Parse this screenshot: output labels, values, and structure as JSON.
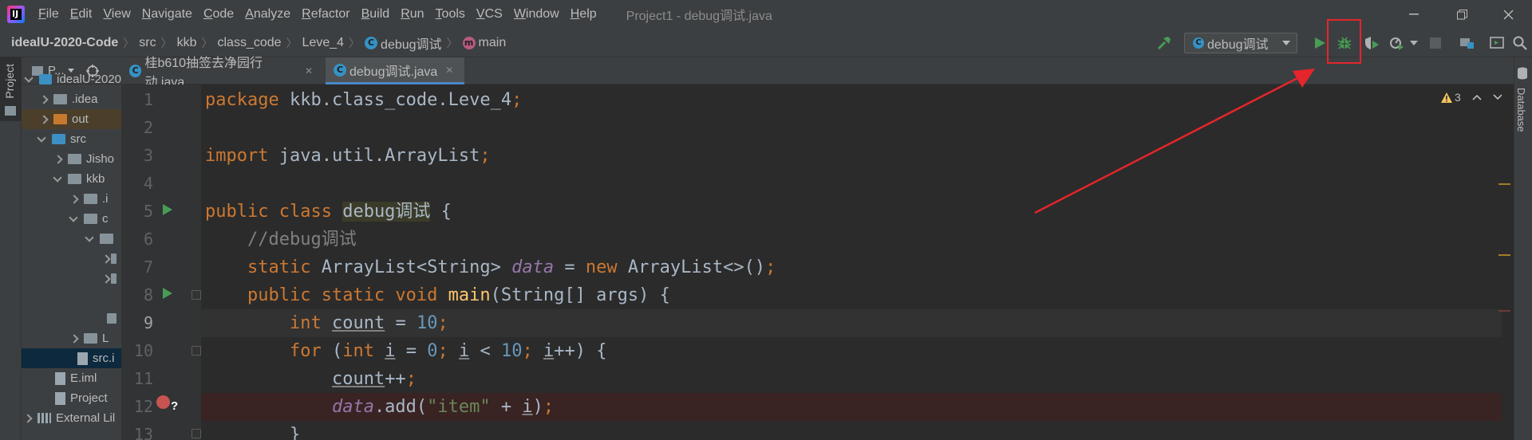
{
  "menu": {
    "items": [
      "File",
      "Edit",
      "View",
      "Navigate",
      "Code",
      "Analyze",
      "Refactor",
      "Build",
      "Run",
      "Tools",
      "VCS",
      "Window",
      "Help"
    ],
    "window_title": "Project1 - debug调试.java"
  },
  "breadcrumb": {
    "project": "idealU-2020-Code",
    "items": [
      "src",
      "kkb",
      "class_code",
      "Leve_4",
      "debug调试",
      "main"
    ]
  },
  "toolbar": {
    "run_config": "debug调试",
    "highlighted": "debug-button"
  },
  "project_panel": {
    "tab_label": "Project",
    "header": "P...",
    "tree": [
      {
        "label": "idealU-2020",
        "icon": "folder"
      },
      {
        "label": ".idea",
        "icon": "folder"
      },
      {
        "label": "out",
        "icon": "folder"
      },
      {
        "label": "src",
        "icon": "folder"
      },
      {
        "label": "Jisho",
        "icon": "package"
      },
      {
        "label": "kkb",
        "icon": "package"
      },
      {
        "label": ".i",
        "icon": "package"
      },
      {
        "label": "c",
        "icon": "package"
      },
      {
        "label": "L",
        "icon": "package"
      },
      {
        "label": "src.i",
        "icon": "file"
      },
      {
        "label": "E.iml",
        "icon": "file"
      },
      {
        "label": "Project",
        "icon": "file"
      },
      {
        "label": "External Lil",
        "icon": "library"
      }
    ]
  },
  "tabs": [
    {
      "label": "桂b610抽签去净园行动.java",
      "active": false
    },
    {
      "label": "debug调试.java",
      "active": true
    }
  ],
  "editor": {
    "line_numbers": [
      "1",
      "2",
      "3",
      "4",
      "5",
      "6",
      "7",
      "8",
      "9",
      "10",
      "11",
      "12",
      "13"
    ],
    "inspection_count": "3"
  },
  "right_strip": {
    "label": "Database"
  },
  "colors": {
    "accent": "#4a88c7",
    "highlight_red": "#e4252b",
    "breakpoint": "#c75450",
    "run_green": "#499c54"
  }
}
